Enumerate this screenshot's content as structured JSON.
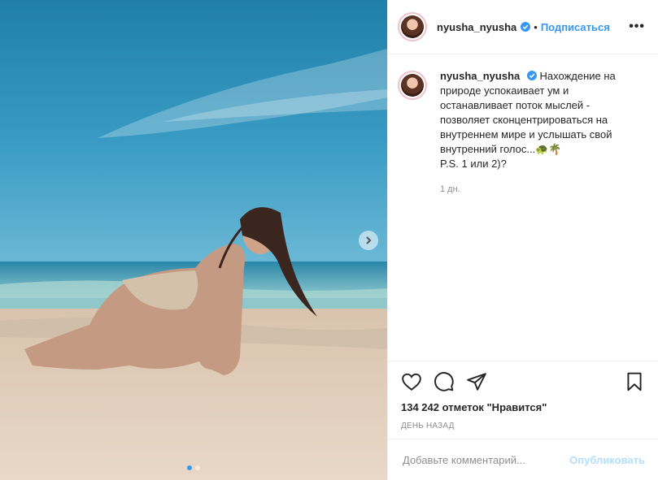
{
  "post": {
    "username": "nyusha_nyusha",
    "follow_label": "Подписаться",
    "separator": "•",
    "more_label": "•••",
    "verified_color": "#3897f0",
    "caption_lines": [
      "Нахождение на",
      "природе успокаивает ум и",
      "останавливает поток мыслей -",
      "позволяет сконцентрироваться на",
      "внутреннем мире и услышать свой",
      "внутренний голос...🐢🌴",
      "P.S. 1 или 2)?"
    ],
    "comment_time": "1 дн.",
    "likes": "134 242 отметок \"Нравится\"",
    "posted_ago": "ДЕНЬ НАЗАД",
    "comment_placeholder": "Добавьте комментарий...",
    "post_button": "Опубликовать",
    "carousel": {
      "slides": 2,
      "active": 1
    }
  },
  "icons": [
    "heart-icon",
    "comment-icon",
    "share-icon",
    "bookmark-icon",
    "chevron-right-icon",
    "verified-badge-icon"
  ]
}
